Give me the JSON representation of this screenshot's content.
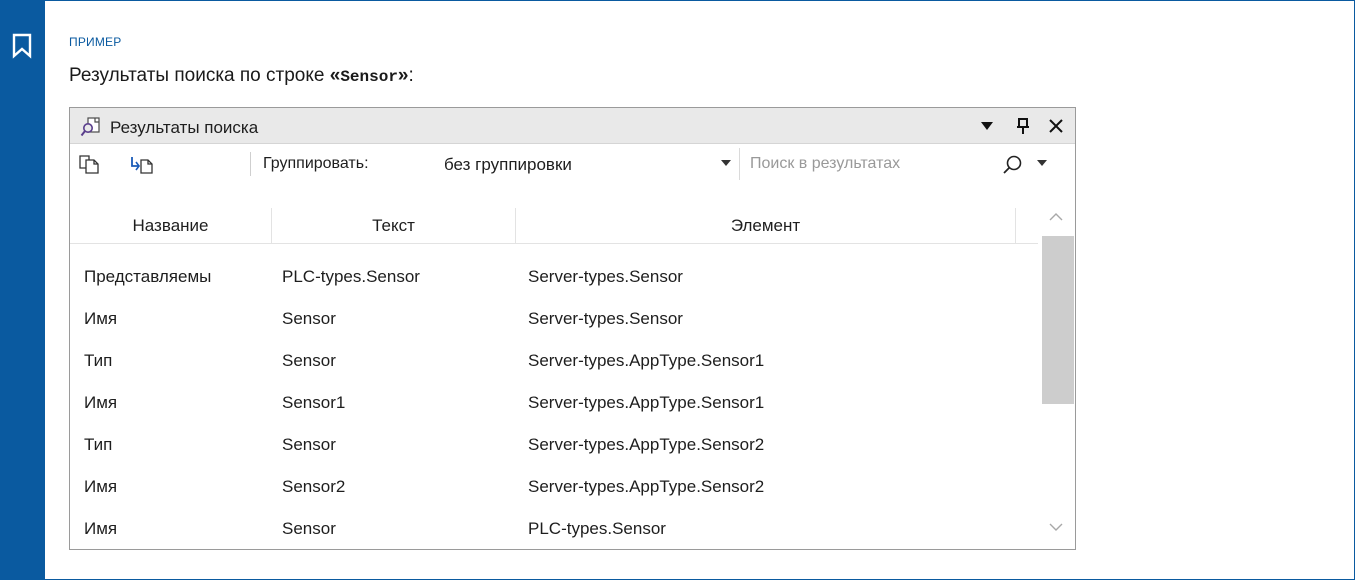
{
  "example_label": "ПРИМЕР",
  "intro": {
    "before": "Результаты поиска по строке ",
    "quote_open": "«",
    "keyword": "Sensor",
    "quote_close": "»",
    "after": ":"
  },
  "window": {
    "title": "Результаты поиска",
    "dropdown_glyph": "▼",
    "pin_glyph": "ᵻ",
    "close_glyph": "✕"
  },
  "toolbar": {
    "group_label": "Группировать:",
    "group_value": "без группировки",
    "search_placeholder": "Поиск в результатах"
  },
  "table": {
    "columns": [
      "Название",
      "Текст",
      "Элемент"
    ],
    "rows": [
      [
        "Представляемы",
        "PLC-types.Sensor",
        "Server-types.Sensor"
      ],
      [
        "Имя",
        "Sensor",
        "Server-types.Sensor"
      ],
      [
        "Тип",
        "Sensor",
        "Server-types.AppType.Sensor1"
      ],
      [
        "Имя",
        "Sensor1",
        "Server-types.AppType.Sensor1"
      ],
      [
        "Тип",
        "Sensor",
        "Server-types.AppType.Sensor2"
      ],
      [
        "Имя",
        "Sensor2",
        "Server-types.AppType.Sensor2"
      ],
      [
        "Имя",
        "Sensor",
        "PLC-types.Sensor"
      ]
    ]
  },
  "colors": {
    "accent": "#0a5aa0",
    "titlebar_bg": "#e9e9e9",
    "scroll_thumb": "#cdcdcd"
  }
}
